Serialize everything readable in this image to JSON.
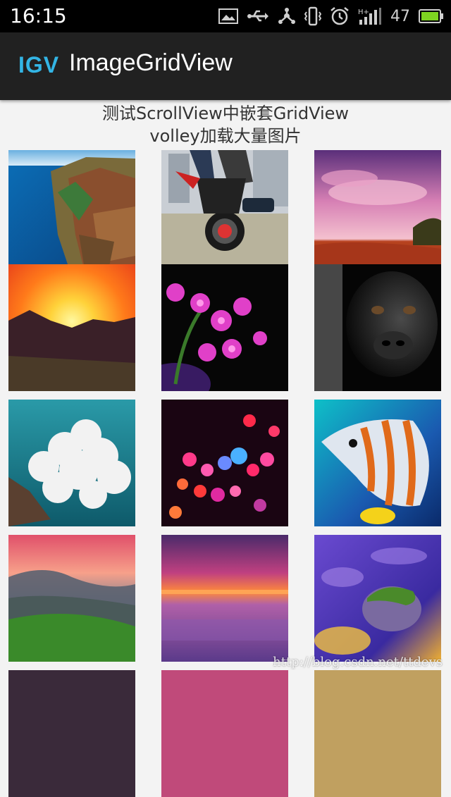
{
  "status_bar": {
    "time": "16:15",
    "battery_level": "47",
    "icons": [
      "image-icon",
      "usb-icon",
      "usb-tether-icon",
      "vibrate-icon",
      "alarm-icon",
      "signal-hplus-icon",
      "battery-icon"
    ]
  },
  "action_bar": {
    "logo_text": "IGV",
    "title": "ImageGridView"
  },
  "header": {
    "line1": "测试ScrollView中嵌套GridView",
    "line2": "volley加载大量图片"
  },
  "grid": {
    "columns": 3,
    "items": [
      {
        "name": "coastline-cliffs"
      },
      {
        "name": "motorcycle-stunt"
      },
      {
        "name": "desert-sunset-clouds"
      },
      {
        "name": "mountain-sunset"
      },
      {
        "name": "pink-orchids"
      },
      {
        "name": "gorilla-portrait"
      },
      {
        "name": "ocean-clouds"
      },
      {
        "name": "bokeh-lights"
      },
      {
        "name": "butterflyfish"
      },
      {
        "name": "misty-hills-sunset"
      },
      {
        "name": "purple-sea-sunset"
      },
      {
        "name": "mossy-rock-water"
      }
    ]
  },
  "watermark": "http://blog.csdn.net/ttdevs",
  "colors": {
    "status_bar_bg": "#000000",
    "action_bar_bg": "#212121",
    "logo_accent": "#33b5e5",
    "page_bg": "#f3f3f3"
  }
}
